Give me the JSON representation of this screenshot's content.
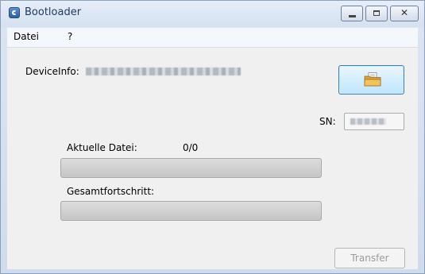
{
  "window": {
    "title": "Bootloader",
    "controls": {
      "close_label": "✕"
    }
  },
  "menu": {
    "items": [
      {
        "label": "Datei"
      },
      {
        "label": "?"
      }
    ]
  },
  "device_info": {
    "label": "DeviceInfo:"
  },
  "open_file_button": {
    "icon": "folder-open-icon"
  },
  "serial": {
    "label": "SN:"
  },
  "current_file": {
    "label": "Aktuelle Datei:",
    "count": "0/0",
    "progress": 0
  },
  "overall": {
    "label": "Gesamtfortschritt:",
    "progress": 0
  },
  "transfer_button": {
    "label": "Transfer",
    "enabled": false
  },
  "colors": {
    "accent": "#3c7fb1",
    "titlebar": "#d5e1f0",
    "client": "#f0f0f0"
  }
}
